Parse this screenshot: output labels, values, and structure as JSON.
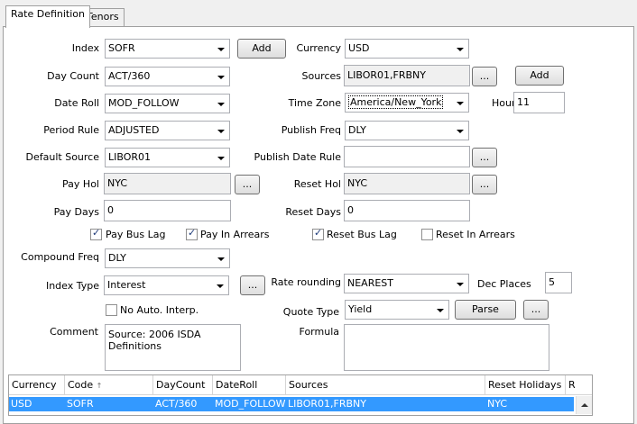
{
  "tabs": [
    "Rate Definition",
    "Tenors"
  ],
  "form": {
    "index_label": "Index",
    "index_value": "SOFR",
    "index_add": "Add",
    "currency_label": "Currency",
    "currency_value": "USD",
    "daycount_label": "Day Count",
    "daycount_value": "ACT/360",
    "sources_label": "Sources",
    "sources_value": "LIBOR01,FRBNY",
    "sources_browse": "...",
    "sources_add": "Add",
    "dateroll_label": "Date Roll",
    "dateroll_value": "MOD_FOLLOW",
    "timezone_label": "Time Zone",
    "timezone_value": "America/New_York",
    "hour_label": "Hour",
    "hour_value": "11",
    "periodrule_label": "Period Rule",
    "periodrule_value": "ADJUSTED",
    "publishfreq_label": "Publish Freq",
    "publishfreq_value": "DLY",
    "defaultsource_label": "Default Source",
    "defaultsource_value": "LIBOR01",
    "publishdaterule_label": "Publish Date Rule",
    "publishdaterule_value": "",
    "publishdaterule_browse": "...",
    "payhol_label": "Pay Hol",
    "payhol_value": "NYC",
    "payhol_browse": "...",
    "resethol_label": "Reset Hol",
    "resethol_value": "NYC",
    "resethol_browse": "...",
    "paydays_label": "Pay Days",
    "paydays_value": "0",
    "resetdays_label": "Reset Days",
    "resetdays_value": "0",
    "paybuslag_label": "Pay Bus Lag",
    "paybuslag_checked": true,
    "payinarrears_label": "Pay In Arrears",
    "payinarrears_checked": true,
    "resetbuslag_label": "Reset Bus Lag",
    "resetbuslag_checked": true,
    "resetinarrears_label": "Reset In Arrears",
    "resetinarrears_checked": false,
    "compoundfreq_label": "Compound Freq",
    "compoundfreq_value": "DLY",
    "indextype_label": "Index Type",
    "indextype_value": "Interest",
    "indextype_browse": "...",
    "raterounding_label": "Rate rounding",
    "raterounding_value": "NEAREST",
    "decplaces_label": "Dec Places",
    "decplaces_value": "5",
    "noautointerp_label": "No Auto. Interp.",
    "noautointerp_checked": false,
    "quotetype_label": "Quote Type",
    "quotetype_value": "Yield",
    "parse_label": "Parse",
    "quotetype_browse": "...",
    "comment_label": "Comment",
    "comment_value": "Source: 2006 ISDA Definitions",
    "formula_label": "Formula",
    "formula_value": ""
  },
  "grid": {
    "columns": [
      "Currency",
      "Code",
      "DayCount",
      "DateRoll",
      "Sources",
      "Reset Holidays",
      "R"
    ],
    "sort_indicator": "↑",
    "rows": [
      {
        "currency": "USD",
        "code": "SOFR",
        "daycount": "ACT/360",
        "dateroll": "MOD_FOLLOW",
        "sources": "LIBOR01,FRBNY",
        "reset_holidays": "NYC"
      }
    ]
  }
}
